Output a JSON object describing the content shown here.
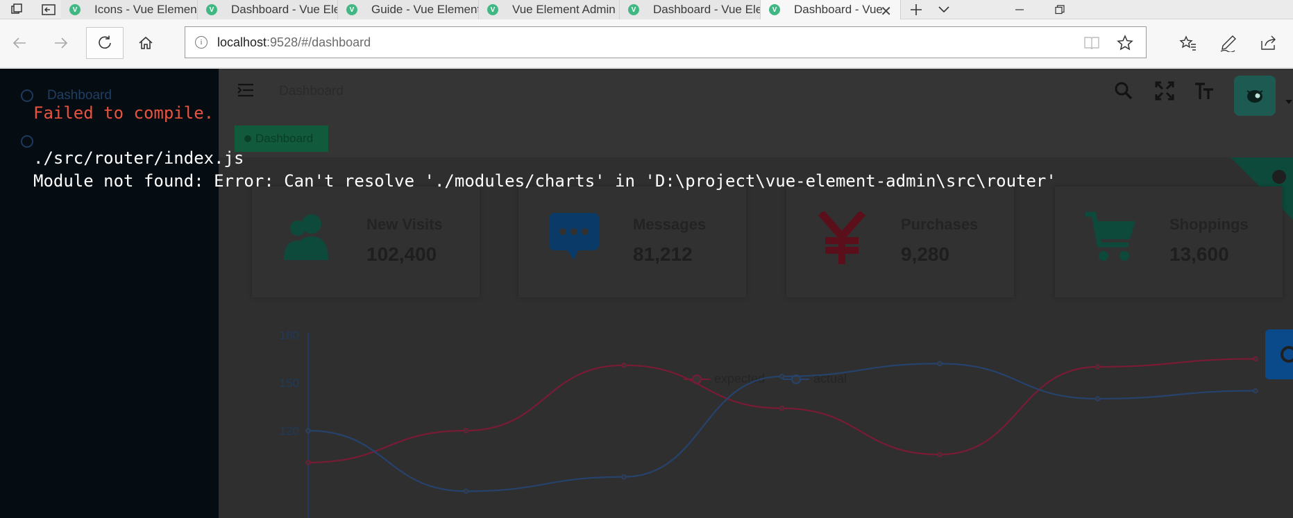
{
  "browser": {
    "tabs": [
      {
        "title": "Icons - Vue Element",
        "active": false
      },
      {
        "title": "Dashboard - Vue Ele",
        "active": false
      },
      {
        "title": "Guide - Vue Element",
        "active": false
      },
      {
        "title": "Vue Element Admin",
        "active": false
      },
      {
        "title": "Dashboard - Vue Ele",
        "active": false
      },
      {
        "title": "Dashboard - Vue",
        "active": true
      }
    ],
    "url_host": "localhost",
    "url_rest": ":9528/#/dashboard"
  },
  "overlay": {
    "title": "Failed to compile.",
    "file": "./src/router/index.js",
    "message": "Module not found: Error: Can't resolve './modules/charts' in 'D:\\project\\vue-element-admin\\src\\router'"
  },
  "app": {
    "sidebar_item": "Dashboard",
    "header_title": "Dashboard",
    "tag": "Dashboard",
    "cards": [
      {
        "label": "New Visits",
        "value": "102,400",
        "icon": "peoples-icon"
      },
      {
        "label": "Messages",
        "value": "81,212",
        "icon": "message-icon"
      },
      {
        "label": "Purchases",
        "value": "9,280",
        "icon": "money-icon"
      },
      {
        "label": "Shoppings",
        "value": "13,600",
        "icon": "shopping-icon"
      }
    ],
    "colors": {
      "expected": "#7a1b35",
      "actual": "#26436e",
      "accent": "#0d4a3c"
    }
  },
  "chart_data": {
    "type": "line",
    "legend": [
      "expected",
      "actual"
    ],
    "y_ticks": [
      "180",
      "150",
      "120"
    ],
    "series": [
      {
        "name": "expected",
        "values": [
          100,
          120,
          161,
          134,
          105,
          160,
          165
        ]
      },
      {
        "name": "actual",
        "values": [
          120,
          82,
          91,
          154,
          162,
          140,
          145
        ]
      }
    ]
  }
}
